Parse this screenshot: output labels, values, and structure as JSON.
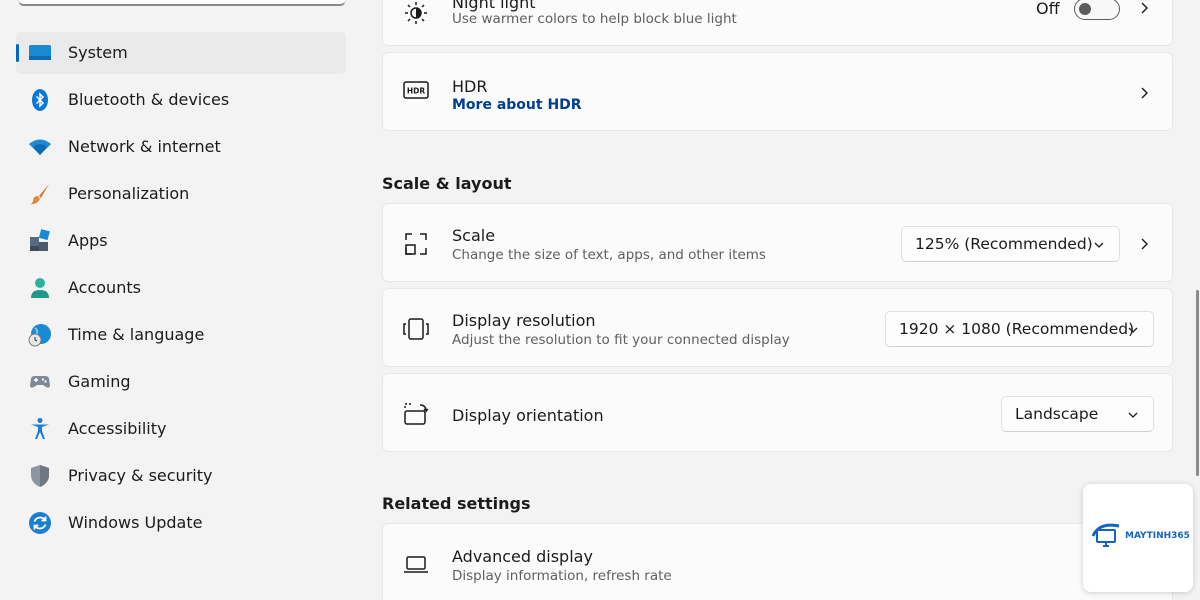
{
  "sidebar": {
    "items": [
      {
        "label": "System",
        "icon": "monitor-icon",
        "active": true
      },
      {
        "label": "Bluetooth & devices",
        "icon": "bluetooth-icon"
      },
      {
        "label": "Network & internet",
        "icon": "wifi-icon"
      },
      {
        "label": "Personalization",
        "icon": "brush-icon"
      },
      {
        "label": "Apps",
        "icon": "apps-icon"
      },
      {
        "label": "Accounts",
        "icon": "person-icon"
      },
      {
        "label": "Time & language",
        "icon": "globe-clock-icon"
      },
      {
        "label": "Gaming",
        "icon": "gamepad-icon"
      },
      {
        "label": "Accessibility",
        "icon": "accessibility-icon"
      },
      {
        "label": "Privacy & security",
        "icon": "shield-icon"
      },
      {
        "label": "Windows Update",
        "icon": "update-icon"
      }
    ]
  },
  "main": {
    "night_light": {
      "title": "Night light",
      "subtitle": "Use warmer colors to help block blue light",
      "toggle_state": "Off",
      "icon": "brightness-icon"
    },
    "hdr": {
      "title": "HDR",
      "link": "More about HDR",
      "icon": "hdr-icon",
      "icon_text": "HDR"
    },
    "scale_layout": {
      "heading": "Scale & layout",
      "scale": {
        "title": "Scale",
        "subtitle": "Change the size of text, apps, and other items",
        "value": "125% (Recommended)",
        "icon": "scale-icon"
      },
      "resolution": {
        "title": "Display resolution",
        "subtitle": "Adjust the resolution to fit your connected display",
        "value": "1920 × 1080 (Recommended)",
        "icon": "resolution-icon"
      },
      "orientation": {
        "title": "Display orientation",
        "value": "Landscape",
        "icon": "orientation-icon"
      }
    },
    "related": {
      "heading": "Related settings",
      "advanced_display": {
        "title": "Advanced display",
        "subtitle": "Display information, refresh rate",
        "icon": "laptop-icon"
      }
    }
  },
  "watermark": {
    "text": "MAYTINH365"
  },
  "colors": {
    "accent": "#0067c0",
    "link": "#003e92",
    "background": "#f3f3f3",
    "card": "#fbfbfb"
  }
}
